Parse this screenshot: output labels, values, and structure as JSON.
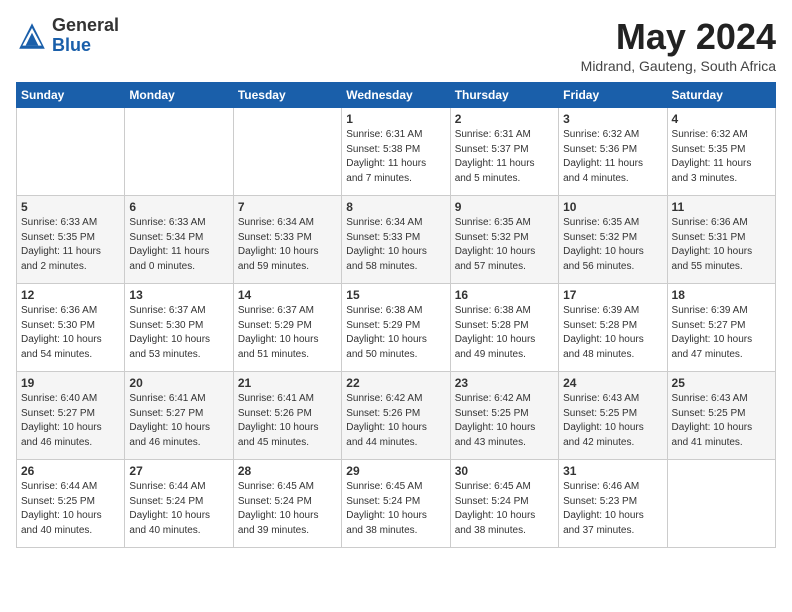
{
  "header": {
    "logo_general": "General",
    "logo_blue": "Blue",
    "month_title": "May 2024",
    "location": "Midrand, Gauteng, South Africa"
  },
  "days_of_week": [
    "Sunday",
    "Monday",
    "Tuesday",
    "Wednesday",
    "Thursday",
    "Friday",
    "Saturday"
  ],
  "weeks": [
    [
      {
        "day": "",
        "info": ""
      },
      {
        "day": "",
        "info": ""
      },
      {
        "day": "",
        "info": ""
      },
      {
        "day": "1",
        "info": "Sunrise: 6:31 AM\nSunset: 5:38 PM\nDaylight: 11 hours\nand 7 minutes."
      },
      {
        "day": "2",
        "info": "Sunrise: 6:31 AM\nSunset: 5:37 PM\nDaylight: 11 hours\nand 5 minutes."
      },
      {
        "day": "3",
        "info": "Sunrise: 6:32 AM\nSunset: 5:36 PM\nDaylight: 11 hours\nand 4 minutes."
      },
      {
        "day": "4",
        "info": "Sunrise: 6:32 AM\nSunset: 5:35 PM\nDaylight: 11 hours\nand 3 minutes."
      }
    ],
    [
      {
        "day": "5",
        "info": "Sunrise: 6:33 AM\nSunset: 5:35 PM\nDaylight: 11 hours\nand 2 minutes."
      },
      {
        "day": "6",
        "info": "Sunrise: 6:33 AM\nSunset: 5:34 PM\nDaylight: 11 hours\nand 0 minutes."
      },
      {
        "day": "7",
        "info": "Sunrise: 6:34 AM\nSunset: 5:33 PM\nDaylight: 10 hours\nand 59 minutes."
      },
      {
        "day": "8",
        "info": "Sunrise: 6:34 AM\nSunset: 5:33 PM\nDaylight: 10 hours\nand 58 minutes."
      },
      {
        "day": "9",
        "info": "Sunrise: 6:35 AM\nSunset: 5:32 PM\nDaylight: 10 hours\nand 57 minutes."
      },
      {
        "day": "10",
        "info": "Sunrise: 6:35 AM\nSunset: 5:32 PM\nDaylight: 10 hours\nand 56 minutes."
      },
      {
        "day": "11",
        "info": "Sunrise: 6:36 AM\nSunset: 5:31 PM\nDaylight: 10 hours\nand 55 minutes."
      }
    ],
    [
      {
        "day": "12",
        "info": "Sunrise: 6:36 AM\nSunset: 5:30 PM\nDaylight: 10 hours\nand 54 minutes."
      },
      {
        "day": "13",
        "info": "Sunrise: 6:37 AM\nSunset: 5:30 PM\nDaylight: 10 hours\nand 53 minutes."
      },
      {
        "day": "14",
        "info": "Sunrise: 6:37 AM\nSunset: 5:29 PM\nDaylight: 10 hours\nand 51 minutes."
      },
      {
        "day": "15",
        "info": "Sunrise: 6:38 AM\nSunset: 5:29 PM\nDaylight: 10 hours\nand 50 minutes."
      },
      {
        "day": "16",
        "info": "Sunrise: 6:38 AM\nSunset: 5:28 PM\nDaylight: 10 hours\nand 49 minutes."
      },
      {
        "day": "17",
        "info": "Sunrise: 6:39 AM\nSunset: 5:28 PM\nDaylight: 10 hours\nand 48 minutes."
      },
      {
        "day": "18",
        "info": "Sunrise: 6:39 AM\nSunset: 5:27 PM\nDaylight: 10 hours\nand 47 minutes."
      }
    ],
    [
      {
        "day": "19",
        "info": "Sunrise: 6:40 AM\nSunset: 5:27 PM\nDaylight: 10 hours\nand 46 minutes."
      },
      {
        "day": "20",
        "info": "Sunrise: 6:41 AM\nSunset: 5:27 PM\nDaylight: 10 hours\nand 46 minutes."
      },
      {
        "day": "21",
        "info": "Sunrise: 6:41 AM\nSunset: 5:26 PM\nDaylight: 10 hours\nand 45 minutes."
      },
      {
        "day": "22",
        "info": "Sunrise: 6:42 AM\nSunset: 5:26 PM\nDaylight: 10 hours\nand 44 minutes."
      },
      {
        "day": "23",
        "info": "Sunrise: 6:42 AM\nSunset: 5:25 PM\nDaylight: 10 hours\nand 43 minutes."
      },
      {
        "day": "24",
        "info": "Sunrise: 6:43 AM\nSunset: 5:25 PM\nDaylight: 10 hours\nand 42 minutes."
      },
      {
        "day": "25",
        "info": "Sunrise: 6:43 AM\nSunset: 5:25 PM\nDaylight: 10 hours\nand 41 minutes."
      }
    ],
    [
      {
        "day": "26",
        "info": "Sunrise: 6:44 AM\nSunset: 5:25 PM\nDaylight: 10 hours\nand 40 minutes."
      },
      {
        "day": "27",
        "info": "Sunrise: 6:44 AM\nSunset: 5:24 PM\nDaylight: 10 hours\nand 40 minutes."
      },
      {
        "day": "28",
        "info": "Sunrise: 6:45 AM\nSunset: 5:24 PM\nDaylight: 10 hours\nand 39 minutes."
      },
      {
        "day": "29",
        "info": "Sunrise: 6:45 AM\nSunset: 5:24 PM\nDaylight: 10 hours\nand 38 minutes."
      },
      {
        "day": "30",
        "info": "Sunrise: 6:45 AM\nSunset: 5:24 PM\nDaylight: 10 hours\nand 38 minutes."
      },
      {
        "day": "31",
        "info": "Sunrise: 6:46 AM\nSunset: 5:23 PM\nDaylight: 10 hours\nand 37 minutes."
      },
      {
        "day": "",
        "info": ""
      }
    ]
  ]
}
